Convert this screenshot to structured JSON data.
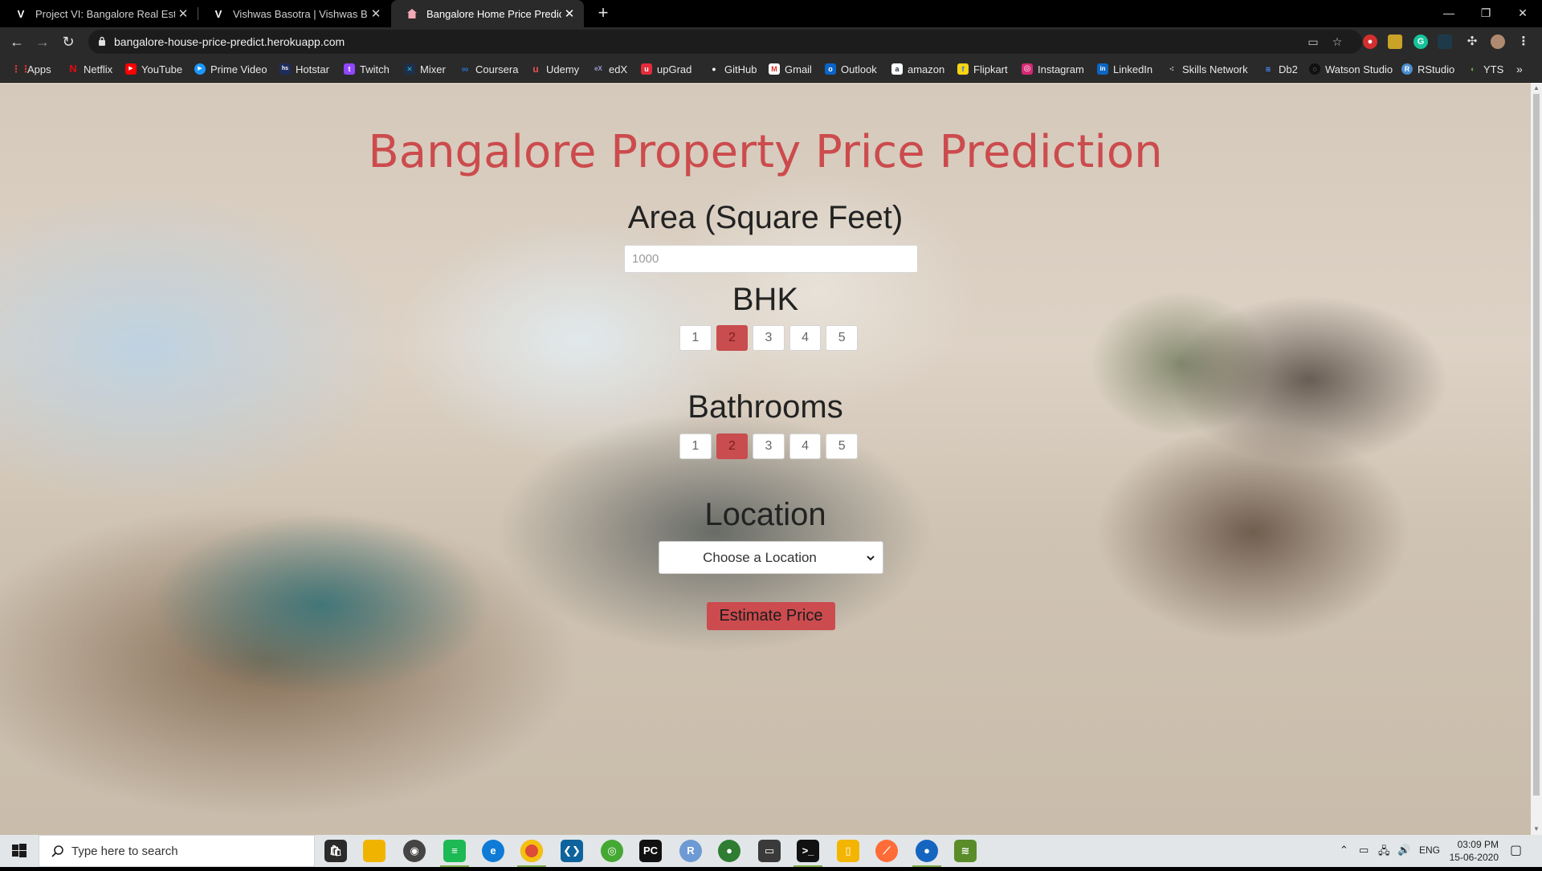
{
  "browser": {
    "tabs": [
      {
        "title": "Project VI: Bangalore Real Estate",
        "icon": "V",
        "active": false
      },
      {
        "title": "Vishwas Basotra | Vishwas Basotra",
        "icon": "V",
        "active": false
      },
      {
        "title": "Bangalore Home Price Prediction",
        "icon": "house",
        "active": true
      }
    ],
    "url": "bangalore-house-price-predict.herokuapp.com",
    "bookmarks": [
      {
        "label": "Apps",
        "icon": "apps-grid",
        "color": "#e53935"
      },
      {
        "label": "Netflix",
        "icon": "netflix",
        "color": "#e50914"
      },
      {
        "label": "YouTube",
        "icon": "youtube",
        "color": "#ff0000"
      },
      {
        "label": "Prime Video",
        "icon": "prime-video",
        "color": "#1a98ff"
      },
      {
        "label": "Hotstar",
        "icon": "hotstar",
        "color": "#1f2d5c"
      },
      {
        "label": "Twitch",
        "icon": "twitch",
        "color": "#9146ff"
      },
      {
        "label": "Mixer",
        "icon": "mixer",
        "color": "#1fbaed"
      },
      {
        "label": "Coursera",
        "icon": "coursera",
        "color": "#2a73cc"
      },
      {
        "label": "Udemy",
        "icon": "udemy",
        "color": "#ec5252"
      },
      {
        "label": "edX",
        "icon": "edx",
        "color": "#02262b"
      },
      {
        "label": "upGrad",
        "icon": "upgrad",
        "color": "#e42c3c"
      },
      {
        "label": "GitHub",
        "icon": "github",
        "color": "#333333"
      },
      {
        "label": "Gmail",
        "icon": "gmail",
        "color": "#d93025"
      },
      {
        "label": "Outlook",
        "icon": "outlook",
        "color": "#0a64c8"
      },
      {
        "label": "amazon",
        "icon": "amazon",
        "color": "#232f3e"
      },
      {
        "label": "Flipkart",
        "icon": "flipkart",
        "color": "#f7d414"
      },
      {
        "label": "Instagram",
        "icon": "instagram",
        "color": "#d62976"
      },
      {
        "label": "LinkedIn",
        "icon": "linkedin",
        "color": "#0a66c2"
      },
      {
        "label": "Skills Network",
        "icon": "skills-network",
        "color": "#6b6b6b"
      },
      {
        "label": "Db2",
        "icon": "db2",
        "color": "#0f62fe"
      },
      {
        "label": "Watson Studio",
        "icon": "watson-studio",
        "color": "#222222"
      },
      {
        "label": "RStudio",
        "icon": "rstudio",
        "color": "#4a8ecf"
      },
      {
        "label": "YTS",
        "icon": "yts",
        "color": "#6ac045"
      }
    ]
  },
  "page": {
    "title": "Bangalore Property Price Prediction",
    "area": {
      "label": "Area (Square Feet)",
      "placeholder": "1000"
    },
    "bhk": {
      "label": "BHK",
      "options": [
        "1",
        "2",
        "3",
        "4",
        "5"
      ],
      "selected": "2"
    },
    "bathrooms": {
      "label": "Bathrooms",
      "options": [
        "1",
        "2",
        "3",
        "4",
        "5"
      ],
      "selected": "2"
    },
    "location": {
      "label": "Location",
      "selected": "Choose a Location"
    },
    "estimate_button": "Estimate Price",
    "accent_color": "#cc4b4e"
  },
  "taskbar": {
    "search_placeholder": "Type here to search",
    "apps": [
      "store-icon",
      "file-explorer-icon",
      "media-player-icon",
      "spotify-icon",
      "edge-icon",
      "chrome-icon",
      "vscode-icon",
      "anaconda-icon",
      "pycharm-icon",
      "r-icon",
      "maps-icon",
      "terminal-icon",
      "cmd-icon",
      "notebook-icon",
      "postman-icon",
      "location-icon",
      "bluestacks-icon"
    ],
    "language": "ENG",
    "time": "03:09 PM",
    "date": "15-06-2020"
  }
}
